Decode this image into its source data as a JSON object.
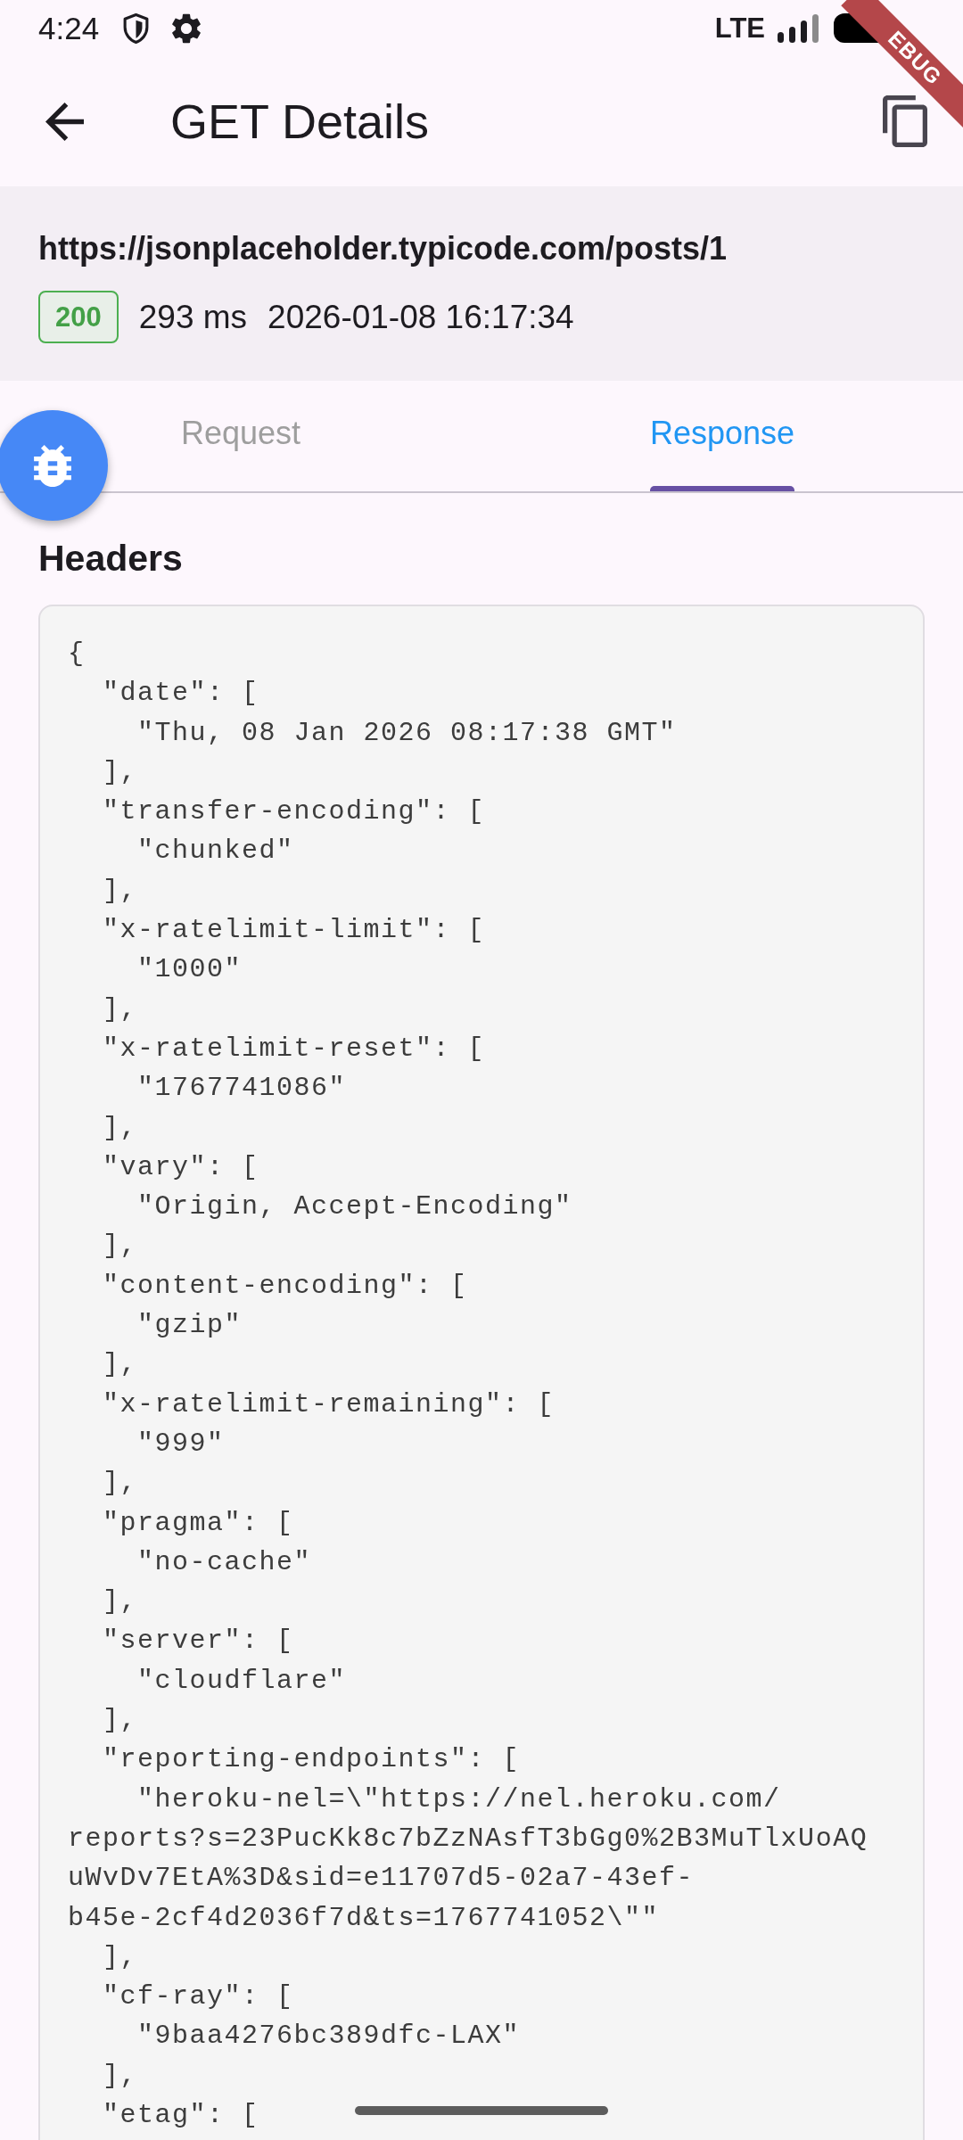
{
  "status_bar": {
    "time": "4:24",
    "network": "LTE"
  },
  "debug_banner": {
    "label": "EBUG"
  },
  "app_bar": {
    "title": "GET Details"
  },
  "request_summary": {
    "url": "https://jsonplaceholder.typicode.com/posts/1",
    "status_code": "200",
    "duration": "293 ms",
    "timestamp": "2026-01-08 16:17:34"
  },
  "tabs": [
    {
      "label": "Request",
      "selected": false
    },
    {
      "label": "Response",
      "selected": true
    }
  ],
  "headers": {
    "title": "Headers",
    "lines": [
      "{",
      "  \"date\": [",
      "    \"Thu, 08 Jan 2026 08:17:38 GMT\"",
      "  ],",
      "  \"transfer-encoding\": [",
      "    \"chunked\"",
      "  ],",
      "  \"x-ratelimit-limit\": [",
      "    \"1000\"",
      "  ],",
      "  \"x-ratelimit-reset\": [",
      "    \"1767741086\"",
      "  ],",
      "  \"vary\": [",
      "    \"Origin, Accept-Encoding\"",
      "  ],",
      "  \"content-encoding\": [",
      "    \"gzip\"",
      "  ],",
      "  \"x-ratelimit-remaining\": [",
      "    \"999\"",
      "  ],",
      "  \"pragma\": [",
      "    \"no-cache\"",
      "  ],",
      "  \"server\": [",
      "    \"cloudflare\"",
      "  ],",
      "  \"reporting-endpoints\": [",
      "    \"heroku-nel=\\\"https://nel.heroku.com/",
      "reports?s=23PucKk8c7bZzNAsfT3bGg0%2B3MuTlxUoAQ",
      "uWvDv7EtA%3D&sid=e11707d5-02a7-43ef-",
      "b45e-2cf4d2036f7d&ts=1767741052\\\"\"",
      "  ],",
      "  \"cf-ray\": [",
      "    \"9baa4276bc389dfc-LAX\"",
      "  ],",
      "  \"etag\": ["
    ]
  }
}
